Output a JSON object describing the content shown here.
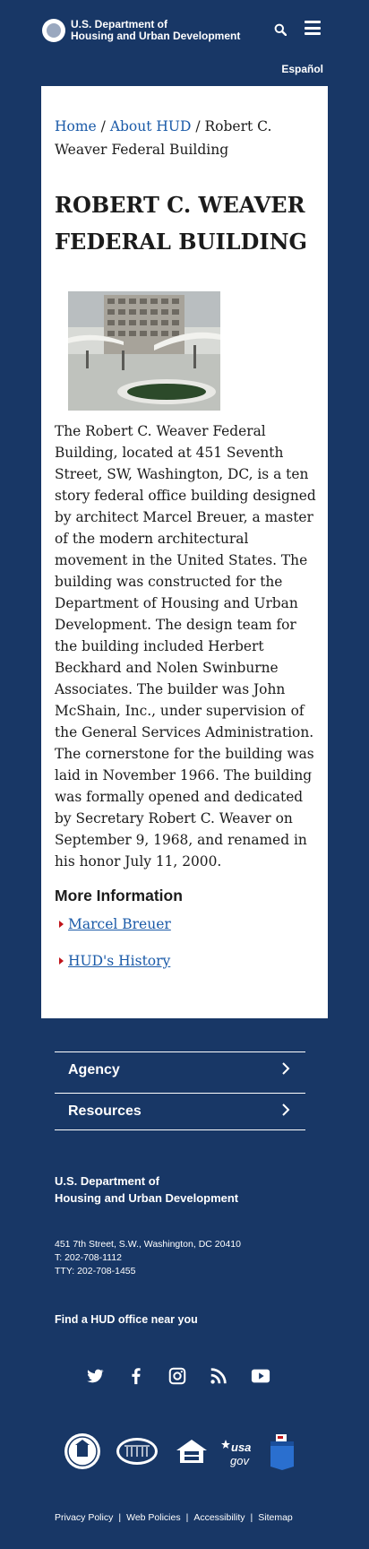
{
  "header": {
    "agency_line1": "U.S. Department of",
    "agency_line2": "Housing and Urban Development",
    "language_link": "Español"
  },
  "breadcrumb": {
    "home": "Home",
    "sep1": " / ",
    "about": "About HUD",
    "sep2": " / ",
    "current": "Robert C. Weaver Federal Building"
  },
  "page": {
    "title": "ROBERT C. WEAVER FEDERAL BUILDING",
    "body": "The Robert C. Weaver Federal Building, located at 451 Seventh Street, SW, Washington, DC, is a ten story federal office building designed by architect Marcel Breuer, a master of the modern architectural movement in the United States. The building was constructed for the Department of Housing and Urban Development. The design team for the building included Herbert Beckhard and Nolen Swinburne Associates. The builder was John McShain, Inc., under supervision of the General Services Administration. The cornerstone for the building was laid in November 1966. The building was formally opened and dedicated by Secretary Robert C. Weaver on September 9, 1968, and renamed in his honor July 11, 2000."
  },
  "more_info": {
    "heading": "More Information",
    "links": [
      "Marcel Breuer",
      "HUD's History"
    ]
  },
  "footer": {
    "accordions": [
      "Agency",
      "Resources"
    ],
    "agency_line1": "U.S. Department of",
    "agency_line2": "Housing and Urban Development",
    "address": "451 7th Street, S.W., Washington, DC 20410",
    "phone": "T: 202-708-1112",
    "tty": "TTY: 202-708-1455",
    "find_office": "Find a HUD office near you",
    "social_icons": [
      "twitter-icon",
      "facebook-icon",
      "instagram-icon",
      "rss-icon",
      "youtube-icon"
    ],
    "badges": [
      "hud-seal",
      "white-house",
      "equal-housing-opportunity",
      "usa-gov",
      "vote"
    ],
    "usa_gov_text": "usa gov",
    "links": [
      "Privacy Policy",
      "Web Policies",
      "Accessibility",
      "Sitemap"
    ],
    "link_separator": "|"
  },
  "colors": {
    "background": "#183766",
    "link": "#1a5aa8",
    "bullet": "#c0141a"
  }
}
